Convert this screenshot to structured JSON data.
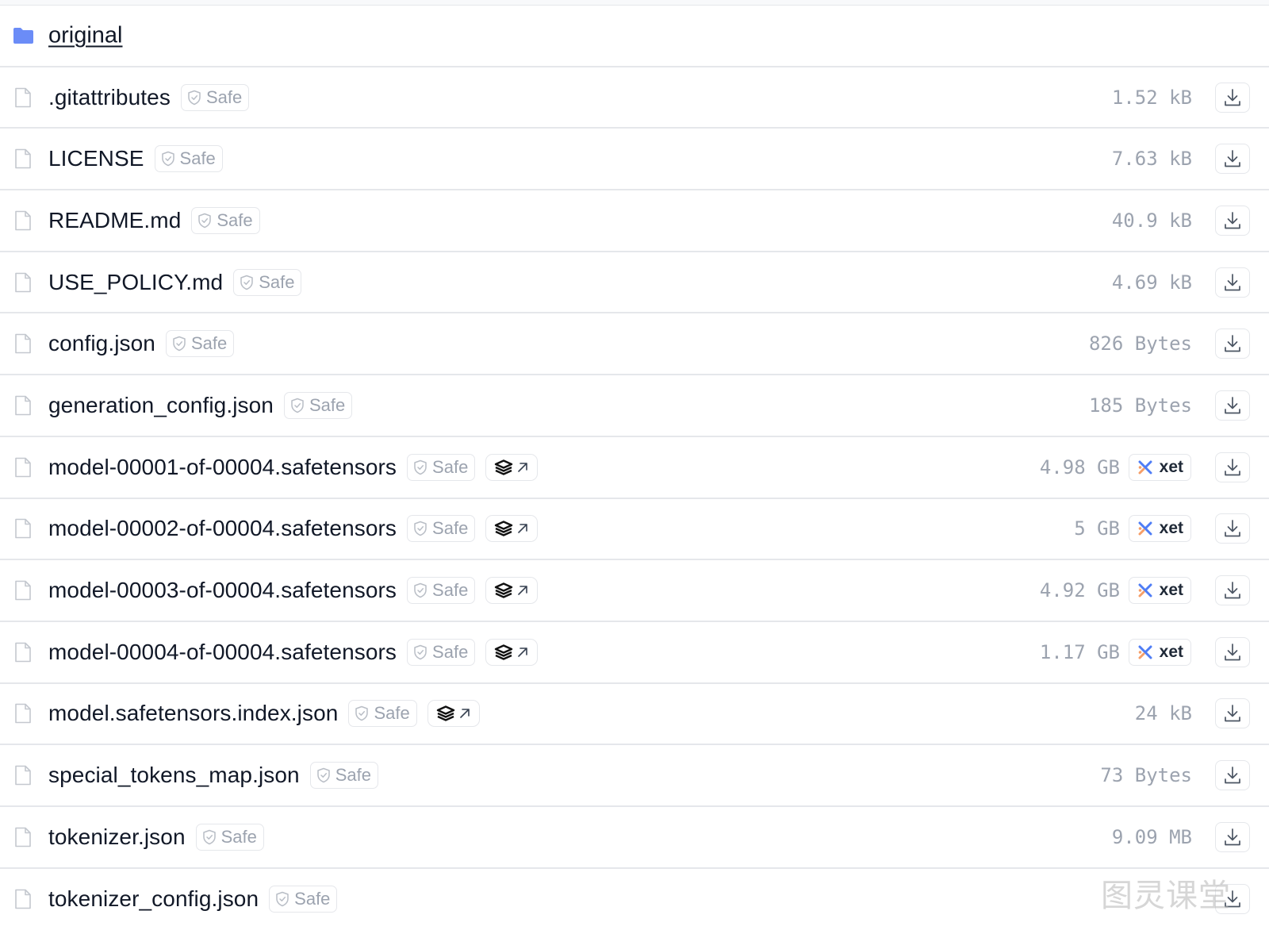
{
  "folder": {
    "name": "original"
  },
  "badges": {
    "safe_label": "Safe",
    "xet_label": "xet"
  },
  "files": [
    {
      "name": ".gitattributes",
      "size": "1.52 kB",
      "safe": true,
      "safetensors": false,
      "xet": false
    },
    {
      "name": "LICENSE",
      "size": "7.63 kB",
      "safe": true,
      "safetensors": false,
      "xet": false
    },
    {
      "name": "README.md",
      "size": "40.9 kB",
      "safe": true,
      "safetensors": false,
      "xet": false
    },
    {
      "name": "USE_POLICY.md",
      "size": "4.69 kB",
      "safe": true,
      "safetensors": false,
      "xet": false
    },
    {
      "name": "config.json",
      "size": "826 Bytes",
      "safe": true,
      "safetensors": false,
      "xet": false
    },
    {
      "name": "generation_config.json",
      "size": "185 Bytes",
      "safe": true,
      "safetensors": false,
      "xet": false
    },
    {
      "name": "model-00001-of-00004.safetensors",
      "size": "4.98 GB",
      "safe": true,
      "safetensors": true,
      "xet": true
    },
    {
      "name": "model-00002-of-00004.safetensors",
      "size": "5 GB",
      "safe": true,
      "safetensors": true,
      "xet": true
    },
    {
      "name": "model-00003-of-00004.safetensors",
      "size": "4.92 GB",
      "safe": true,
      "safetensors": true,
      "xet": true
    },
    {
      "name": "model-00004-of-00004.safetensors",
      "size": "1.17 GB",
      "safe": true,
      "safetensors": true,
      "xet": true
    },
    {
      "name": "model.safetensors.index.json",
      "size": "24 kB",
      "safe": true,
      "safetensors": true,
      "xet": false
    },
    {
      "name": "special_tokens_map.json",
      "size": "73 Bytes",
      "safe": true,
      "safetensors": false,
      "xet": false
    },
    {
      "name": "tokenizer.json",
      "size": "9.09 MB",
      "safe": true,
      "safetensors": false,
      "xet": false
    },
    {
      "name": "tokenizer_config.json",
      "size": "",
      "safe": true,
      "safetensors": false,
      "xet": false
    }
  ],
  "watermark": "图灵课堂",
  "icons": {
    "folder": "folder-icon",
    "file": "file-icon",
    "safe": "shield-check-icon",
    "safetensors": "safetensors-stack-icon",
    "external": "arrow-up-right-icon",
    "xet": "xet-logo-icon",
    "download": "download-icon"
  },
  "colors": {
    "folder": "#6b8cf7",
    "xet_blue": "#4f7df5",
    "xet_orange": "#f59e68"
  }
}
